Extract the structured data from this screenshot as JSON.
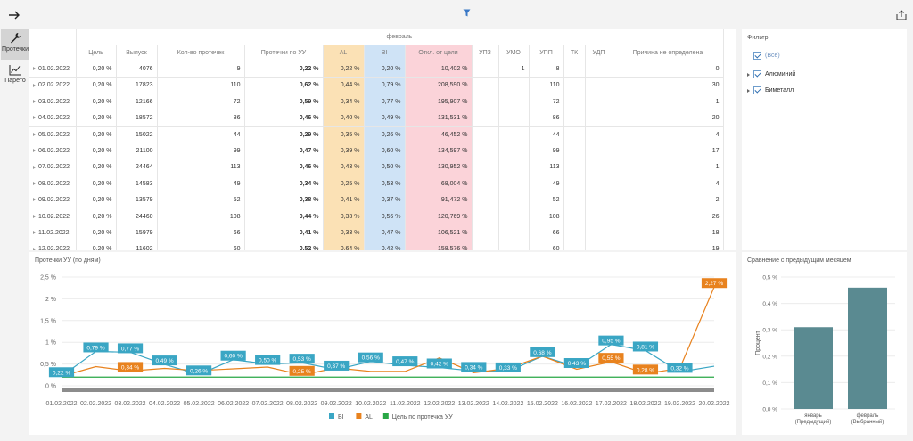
{
  "toolbar": {
    "back_icon": "arrow-right-icon",
    "filter_icon": "filter-icon",
    "share_icon": "share-icon"
  },
  "nav": {
    "items": [
      {
        "label": "Протечки",
        "icon": "wrench-icon",
        "active": true
      },
      {
        "label": "Парето",
        "icon": "line-chart-icon",
        "active": false
      }
    ]
  },
  "table": {
    "month": "февраль",
    "columns": [
      "Цель",
      "Выпуск",
      "Кол-во протечек",
      "Протечки по УУ",
      "AL",
      "BI",
      "Откл. от цели",
      "УПЗ",
      "УМО",
      "УПП",
      "ТК",
      "УДП",
      "Причина не определена"
    ],
    "rows": [
      {
        "date": "01.02.2022",
        "goal": "0,20 %",
        "output": "4076",
        "count": "9",
        "uu": "0,22 %",
        "al": "0,22 %",
        "bi": "0,20 %",
        "dev": "10,402 %",
        "upz": "",
        "umo": "1",
        "upp": "8",
        "tk": "",
        "udp": "",
        "unknown": "0"
      },
      {
        "date": "02.02.2022",
        "goal": "0,20 %",
        "output": "17823",
        "count": "110",
        "uu": "0,62 %",
        "al": "0,44 %",
        "bi": "0,79 %",
        "dev": "208,590 %",
        "upz": "",
        "umo": "",
        "upp": "110",
        "tk": "",
        "udp": "",
        "unknown": "30"
      },
      {
        "date": "03.02.2022",
        "goal": "0,20 %",
        "output": "12166",
        "count": "72",
        "uu": "0,59 %",
        "al": "0,34 %",
        "bi": "0,77 %",
        "dev": "195,907 %",
        "upz": "",
        "umo": "",
        "upp": "72",
        "tk": "",
        "udp": "",
        "unknown": "1"
      },
      {
        "date": "04.02.2022",
        "goal": "0,20 %",
        "output": "18572",
        "count": "86",
        "uu": "0,46 %",
        "al": "0,40 %",
        "bi": "0,49 %",
        "dev": "131,531 %",
        "upz": "",
        "umo": "",
        "upp": "86",
        "tk": "",
        "udp": "",
        "unknown": "20"
      },
      {
        "date": "05.02.2022",
        "goal": "0,20 %",
        "output": "15022",
        "count": "44",
        "uu": "0,29 %",
        "al": "0,35 %",
        "bi": "0,26 %",
        "dev": "46,452 %",
        "upz": "",
        "umo": "",
        "upp": "44",
        "tk": "",
        "udp": "",
        "unknown": "4"
      },
      {
        "date": "06.02.2022",
        "goal": "0,20 %",
        "output": "21100",
        "count": "99",
        "uu": "0,47 %",
        "al": "0,39 %",
        "bi": "0,60 %",
        "dev": "134,597 %",
        "upz": "",
        "umo": "",
        "upp": "99",
        "tk": "",
        "udp": "",
        "unknown": "17"
      },
      {
        "date": "07.02.2022",
        "goal": "0,20 %",
        "output": "24464",
        "count": "113",
        "uu": "0,46 %",
        "al": "0,43 %",
        "bi": "0,50 %",
        "dev": "130,952 %",
        "upz": "",
        "umo": "",
        "upp": "113",
        "tk": "",
        "udp": "",
        "unknown": "1"
      },
      {
        "date": "08.02.2022",
        "goal": "0,20 %",
        "output": "14583",
        "count": "49",
        "uu": "0,34 %",
        "al": "0,25 %",
        "bi": "0,53 %",
        "dev": "68,004 %",
        "upz": "",
        "umo": "",
        "upp": "49",
        "tk": "",
        "udp": "",
        "unknown": "4"
      },
      {
        "date": "09.02.2022",
        "goal": "0,20 %",
        "output": "13579",
        "count": "52",
        "uu": "0,38 %",
        "al": "0,41 %",
        "bi": "0,37 %",
        "dev": "91,472 %",
        "upz": "",
        "umo": "",
        "upp": "52",
        "tk": "",
        "udp": "",
        "unknown": "2"
      },
      {
        "date": "10.02.2022",
        "goal": "0,20 %",
        "output": "24460",
        "count": "108",
        "uu": "0,44 %",
        "al": "0,33 %",
        "bi": "0,56 %",
        "dev": "120,769 %",
        "upz": "",
        "umo": "",
        "upp": "108",
        "tk": "",
        "udp": "",
        "unknown": "26"
      },
      {
        "date": "11.02.2022",
        "goal": "0,20 %",
        "output": "15979",
        "count": "66",
        "uu": "0,41 %",
        "al": "0,33 %",
        "bi": "0,47 %",
        "dev": "106,521 %",
        "upz": "",
        "umo": "",
        "upp": "66",
        "tk": "",
        "udp": "",
        "unknown": "18"
      },
      {
        "date": "12.02.2022",
        "goal": "0,20 %",
        "output": "11602",
        "count": "60",
        "uu": "0,52 %",
        "al": "0,64 %",
        "bi": "0,42 %",
        "dev": "158,576 %",
        "upz": "",
        "umo": "",
        "upp": "60",
        "tk": "",
        "udp": "",
        "unknown": "19"
      }
    ]
  },
  "filter": {
    "title": "Фильтр",
    "items": [
      {
        "label": "(Все)",
        "expandable": false
      },
      {
        "label": "Алюминий",
        "expandable": true
      },
      {
        "label": "Биметалл",
        "expandable": true
      }
    ]
  },
  "line_chart": {
    "title": "Протечки УУ (по дням)",
    "legend": [
      "BI",
      "AL",
      "Цель по протечка УУ"
    ]
  },
  "bar_chart": {
    "title": "Сравнение с предыдущим месяцем"
  },
  "colors": {
    "bi": "#3aa6c4",
    "al": "#e8821e",
    "goal": "#28a745",
    "bar": "#5a8a91",
    "al_cell": "#fbe1b5",
    "bi_cell": "#cfe3f6",
    "dev_cell": "#fbd3d9"
  },
  "chart_data": [
    {
      "type": "line",
      "title": "Протечки УУ (по дням)",
      "x": [
        "01.02.2022",
        "02.02.2022",
        "03.02.2022",
        "04.02.2022",
        "05.02.2022",
        "06.02.2022",
        "07.02.2022",
        "08.02.2022",
        "09.02.2022",
        "10.02.2022",
        "11.02.2022",
        "12.02.2022",
        "13.02.2022",
        "14.02.2022",
        "15.02.2022",
        "16.02.2022",
        "17.02.2022",
        "18.02.2022",
        "19.02.2022",
        "20.02.2022"
      ],
      "y_ticks": [
        "0 %",
        "0,5 %",
        "1 %",
        "1,5 %",
        "2 %",
        "2,5 %"
      ],
      "ylim": [
        0,
        2.5
      ],
      "series": [
        {
          "name": "BI",
          "values": [
            0.22,
            0.79,
            0.77,
            0.49,
            0.26,
            0.6,
            0.5,
            0.53,
            0.37,
            0.56,
            0.47,
            0.42,
            0.34,
            0.33,
            0.68,
            0.43,
            0.95,
            0.81,
            0.32,
            0.45
          ],
          "labels": {
            "0": "0,22 %",
            "1": "0,79 %",
            "2": "0,77 %",
            "3": "0,49 %",
            "4": "0,26 %",
            "5": "0,60 %",
            "6": "0,50 %",
            "7": "0,53 %",
            "8": "0,37 %",
            "9": "0,56 %",
            "10": "0,47 %",
            "11": "0,42 %",
            "12": "0,34 %",
            "13": "0,33 %",
            "14": "0,68 %",
            "15": "0,43 %",
            "16": "0,95 %",
            "17": "0,81 %",
            "18": "0,32 %"
          }
        },
        {
          "name": "AL",
          "values": [
            0.22,
            0.44,
            0.34,
            0.4,
            0.35,
            0.39,
            0.43,
            0.25,
            0.41,
            0.33,
            0.33,
            0.64,
            0.3,
            0.4,
            0.68,
            0.38,
            0.55,
            0.28,
            0.4,
            2.27
          ],
          "labels": {
            "2": "0,34 %",
            "7": "0,25 %",
            "16": "0,55 %",
            "17": "0,28 %",
            "19": "2,27 %"
          }
        },
        {
          "name": "Цель по протечка УУ",
          "values": [
            0.2,
            0.2,
            0.2,
            0.2,
            0.2,
            0.2,
            0.2,
            0.2,
            0.2,
            0.2,
            0.2,
            0.2,
            0.2,
            0.2,
            0.2,
            0.2,
            0.2,
            0.2,
            0.2,
            0.2
          ]
        }
      ]
    },
    {
      "type": "bar",
      "title": "Сравнение с предыдущим месяцем",
      "categories": [
        "январь (Предыдущий)",
        "февраль (Выбранный)"
      ],
      "values": [
        0.31,
        0.46
      ],
      "ylabel": "Процент",
      "y_ticks": [
        "0,0 %",
        "0,1 %",
        "0,2 %",
        "0,3 %",
        "0,4 %",
        "0,5 %"
      ],
      "ylim": [
        0,
        0.5
      ]
    }
  ]
}
